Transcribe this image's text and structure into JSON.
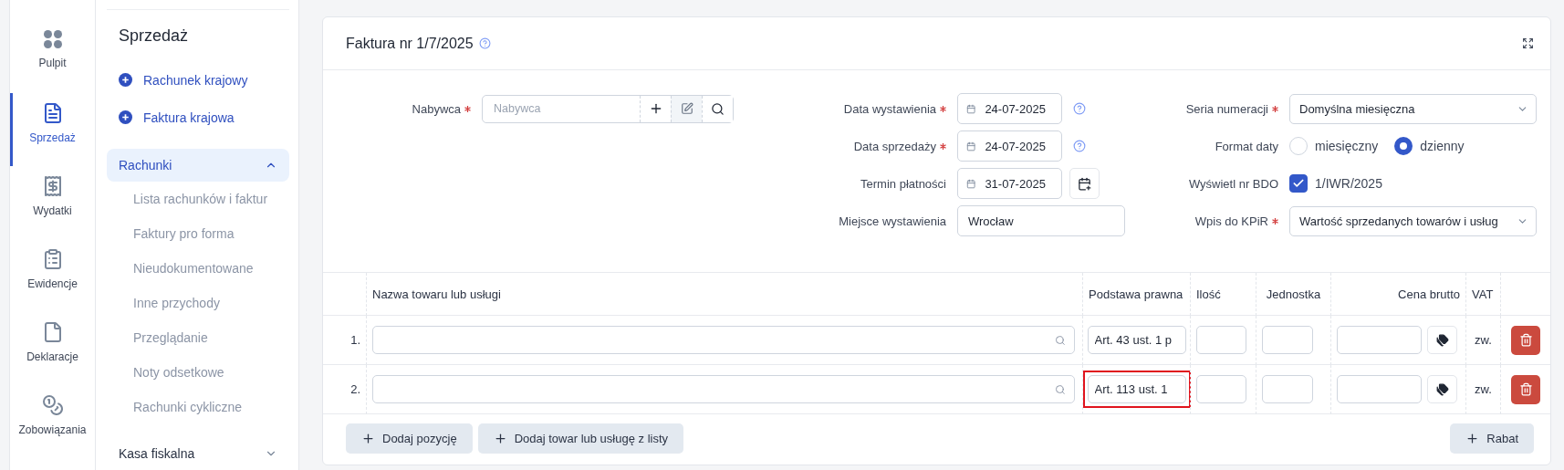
{
  "nav_rail": [
    {
      "label": "Pulpit",
      "kind": "dots",
      "selected": false
    },
    {
      "label": "Sprzedaż",
      "kind": "sales",
      "selected": true
    },
    {
      "label": "Wydatki",
      "kind": "receipt",
      "selected": false
    },
    {
      "label": "Ewidencje",
      "kind": "clipboard",
      "selected": false
    },
    {
      "label": "Deklaracje",
      "kind": "file",
      "selected": false
    },
    {
      "label": "Zobowiązania",
      "kind": "coins",
      "selected": false
    }
  ],
  "sidebar": {
    "title": "Sprzedaż",
    "actions": [
      "Rachunek krajowy",
      "Faktura krajowa"
    ],
    "groups": [
      {
        "label": "Rachunki",
        "expanded": true,
        "children": [
          "Lista rachunków i faktur",
          "Faktury pro forma",
          "Nieudokumentowane",
          "Inne przychody",
          "Przeglądanie",
          "Noty odsetkowe",
          "Rachunki cykliczne"
        ]
      },
      {
        "label": "Kasa fiskalna",
        "expanded": false
      }
    ]
  },
  "invoice": {
    "title": "Faktura nr 1/7/2025",
    "buyer": {
      "label": "Nabywca",
      "required": true,
      "placeholder": "Nabywca"
    },
    "dates": [
      {
        "label": "Data wystawienia",
        "required": true,
        "kind": "date-help",
        "value": "24-07-2025"
      },
      {
        "label": "Data sprzedaży",
        "required": true,
        "kind": "date-help",
        "value": "24-07-2025"
      },
      {
        "label": "Termin płatności",
        "required": false,
        "kind": "date-calendar",
        "value": "31-07-2025"
      },
      {
        "label": "Miejsce wystawienia",
        "required": false,
        "kind": "text",
        "value": "Wrocław"
      }
    ],
    "settings": [
      {
        "label": "Seria numeracji",
        "required": true,
        "kind": "select",
        "value": "Domyślna miesięczna"
      },
      {
        "label": "Format daty",
        "required": false,
        "kind": "radio",
        "options": [
          {
            "label": "miesięczny",
            "selected": false
          },
          {
            "label": "dzienny",
            "selected": true
          }
        ]
      },
      {
        "label": "Wyświetl nr BDO",
        "required": false,
        "kind": "checkbox",
        "checked": true,
        "value": "1/IWR/2025"
      },
      {
        "label": "Wpis do KPiR",
        "required": true,
        "kind": "select",
        "value": "Wartość sprzedanych towarów i usług"
      }
    ],
    "table": {
      "columns": [
        "Nazwa towaru lub usługi",
        "Podstawa prawna",
        "Ilość",
        "Jednostka",
        "Cena brutto",
        "VAT"
      ],
      "rows": [
        {
          "number": "1.",
          "legal_basis": "Art. 43 ust. 1 p",
          "vat": "zw.",
          "highlighted": false
        },
        {
          "number": "2.",
          "legal_basis": "Art. 113 ust. 1",
          "vat": "zw.",
          "highlighted": true
        }
      ]
    },
    "buttons": [
      "Dodaj pozycję",
      "Dodaj towar lub usługę z listy"
    ],
    "discount_button": "Rabat"
  }
}
